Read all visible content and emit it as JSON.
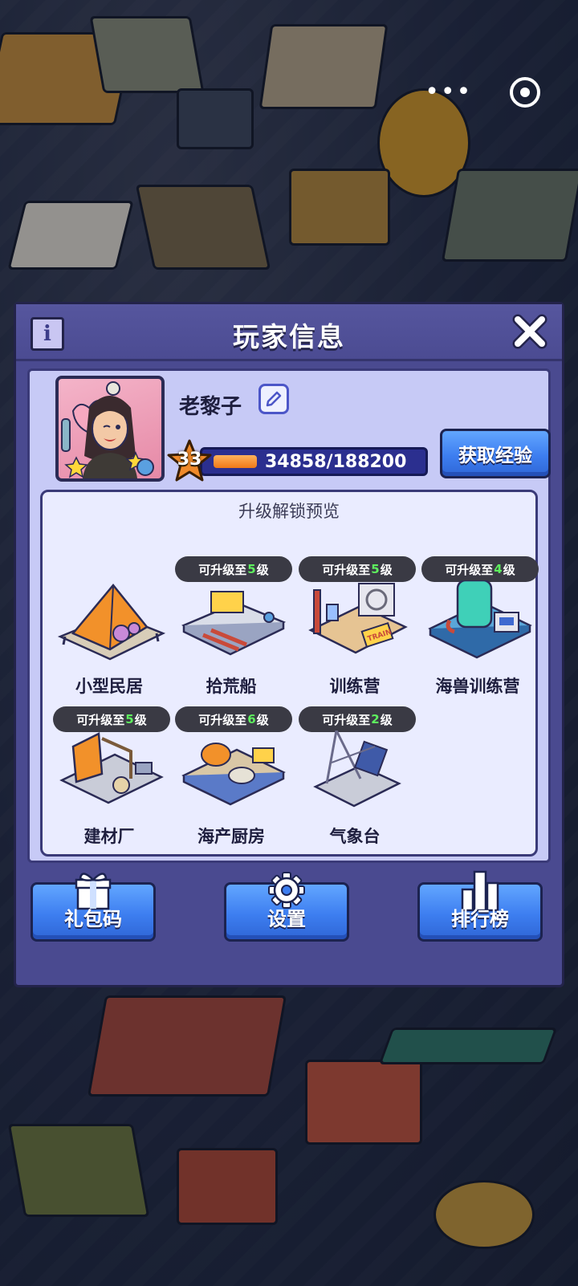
{
  "capsule": {
    "more_icon": "more-dots-icon",
    "close_icon": "target-circle-icon"
  },
  "modal": {
    "title": "玩家信息",
    "info_icon": "i",
    "close_icon": "close-x-icon"
  },
  "player": {
    "name": "老黎子",
    "level": "33",
    "xp_text": "34858/188200",
    "xp_fraction": 0.185,
    "get_exp_label": "获取经验"
  },
  "preview": {
    "title": "升级解锁预览",
    "buildings": [
      {
        "name": "小型民居",
        "badge": ""
      },
      {
        "name": "拾荒船",
        "badge_prefix": "可升级至",
        "badge_level": "5",
        "badge_suffix": "级"
      },
      {
        "name": "训练营",
        "badge_prefix": "可升级至",
        "badge_level": "5",
        "badge_suffix": "级"
      },
      {
        "name": "海兽训练营",
        "badge_prefix": "可升级至",
        "badge_level": "4",
        "badge_suffix": "级"
      },
      {
        "name": "建材厂",
        "badge_prefix": "可升级至",
        "badge_level": "5",
        "badge_suffix": "级"
      },
      {
        "name": "海产厨房",
        "badge_prefix": "可升级至",
        "badge_level": "6",
        "badge_suffix": "级"
      },
      {
        "name": "气象台",
        "badge_prefix": "可升级至",
        "badge_level": "2",
        "badge_suffix": "级"
      }
    ],
    "train_sign": "TRAIN"
  },
  "footer": {
    "gift_code": "礼包码",
    "settings": "设置",
    "leaderboard": "排行榜"
  },
  "colors": {
    "modal_bg": "#4a4a90",
    "panel_bg": "#c7caf6",
    "button_blue": "#3d7ef0",
    "level_green": "#5ef05e",
    "xp_orange": "#f07818"
  }
}
